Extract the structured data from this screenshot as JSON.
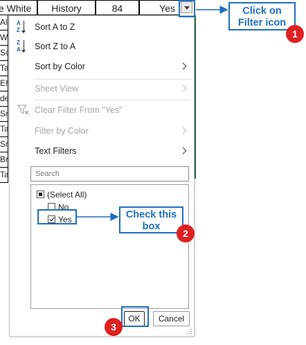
{
  "sheet": {
    "header_cells": [
      "e White",
      "History",
      "84",
      "Yes"
    ],
    "left_cells": [
      "All",
      "Wil",
      "Sco",
      "Ta",
      "Ehr",
      "der",
      "Sm",
      "Ta",
      "Sm",
      "Br",
      "Ta"
    ]
  },
  "menu": {
    "sort_az": "Sort A to Z",
    "sort_za": "Sort Z to A",
    "sort_by_color": "Sort by Color",
    "sheet_view": "Sheet View",
    "clear_filter": "Clear Filter From \"Yes\"",
    "filter_by_color": "Filter by Color",
    "text_filters": "Text Filters",
    "sort_az_icon": {
      "top": "A",
      "bottom": "Z"
    },
    "sort_za_icon": {
      "top": "Z",
      "bottom": "A"
    }
  },
  "search": {
    "placeholder": "Search"
  },
  "filter_list": {
    "items": [
      {
        "label": "(Select All)",
        "state": "partial"
      },
      {
        "label": "No",
        "state": "unchecked"
      },
      {
        "label": "Yes",
        "state": "checked"
      }
    ]
  },
  "buttons": {
    "ok": "OK",
    "cancel": "Cancel"
  },
  "annotations": {
    "callout1": "Click on Filter icon",
    "callout1_line1": "Click on",
    "callout1_line2": "Filter icon",
    "callout2_line1": "Check this",
    "callout2_line2": "box",
    "badge1": "1",
    "badge2": "2",
    "badge3": "3"
  },
  "colors": {
    "accent": "#1f6fc0",
    "badge": "#e02020",
    "excel_green": "#217346"
  }
}
